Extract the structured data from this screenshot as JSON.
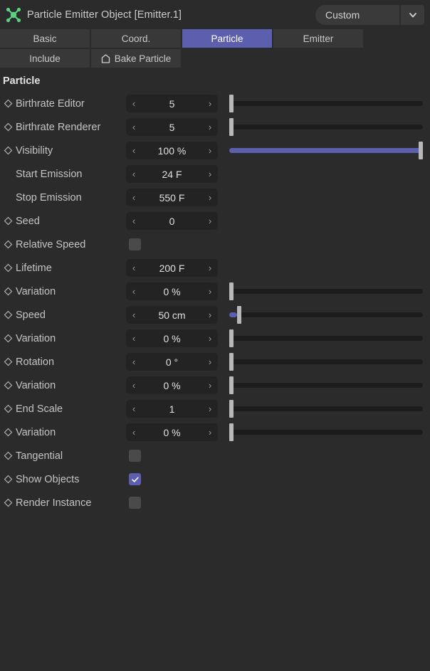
{
  "titlebar": {
    "icon": "particle-emitter-icon",
    "title": "Particle Emitter Object [Emitter.1]",
    "preset_value": "Custom",
    "preset_chevron": "chevron-down-icon"
  },
  "tabs_primary": [
    {
      "label": "Basic",
      "active": false
    },
    {
      "label": "Coord.",
      "active": false
    },
    {
      "label": "Particle",
      "active": true
    },
    {
      "label": "Emitter",
      "active": false
    }
  ],
  "tabs_secondary": [
    {
      "label": "Include",
      "active": false,
      "icon": null
    },
    {
      "label": "Bake Particle",
      "active": false,
      "icon": "bake-home-icon"
    }
  ],
  "section": {
    "title": "Particle"
  },
  "colors": {
    "accent": "#5c5fae",
    "panel_bg": "#2b2b2b",
    "field_bg": "#232323",
    "tab_bg": "#383838",
    "text": "#c4c4c4",
    "handle": "#b8b8b8",
    "icon_green": "#5bd182"
  },
  "properties": [
    {
      "keyframe": true,
      "label": "Birthrate Editor",
      "type": "number",
      "value": "5",
      "prev": "‹",
      "next": "›",
      "slider": {
        "fill_pct": 0,
        "handle_pct": 0
      }
    },
    {
      "keyframe": true,
      "label": "Birthrate Renderer",
      "type": "number",
      "value": "5",
      "prev": "‹",
      "next": "›",
      "slider": {
        "fill_pct": 0,
        "handle_pct": 0
      }
    },
    {
      "keyframe": true,
      "label": "Visibility",
      "type": "number",
      "value": "100 %",
      "prev": "‹",
      "next": "›",
      "slider": {
        "fill_pct": 100,
        "handle_pct": 100
      }
    },
    {
      "keyframe": false,
      "label": "Start Emission",
      "type": "number",
      "value": "24 F",
      "prev": "‹",
      "next": "›",
      "slider": null
    },
    {
      "keyframe": false,
      "label": "Stop Emission",
      "type": "number",
      "value": "550 F",
      "prev": "‹",
      "next": "›",
      "slider": null
    },
    {
      "keyframe": true,
      "label": "Seed",
      "type": "number",
      "value": "0",
      "prev": "‹",
      "next": "›",
      "slider": null
    },
    {
      "keyframe": true,
      "label": "Relative Speed",
      "type": "checkbox",
      "checked": false
    },
    {
      "keyframe": true,
      "label": "Lifetime",
      "type": "number",
      "value": "200 F",
      "prev": "‹",
      "next": "›",
      "slider": null
    },
    {
      "keyframe": true,
      "label": "Variation",
      "type": "number",
      "value": "0 %",
      "prev": "‹",
      "next": "›",
      "slider": {
        "fill_pct": 0,
        "handle_pct": 0
      }
    },
    {
      "keyframe": true,
      "label": "Speed",
      "type": "number",
      "value": "50 cm",
      "prev": "‹",
      "next": "›",
      "slider": {
        "fill_pct": 4,
        "handle_pct": 4
      }
    },
    {
      "keyframe": true,
      "label": "Variation",
      "type": "number",
      "value": "0 %",
      "prev": "‹",
      "next": "›",
      "slider": {
        "fill_pct": 0,
        "handle_pct": 0
      }
    },
    {
      "keyframe": true,
      "label": "Rotation",
      "type": "number",
      "value": "0 °",
      "prev": "‹",
      "next": "›",
      "slider": {
        "fill_pct": 0,
        "handle_pct": 0
      }
    },
    {
      "keyframe": true,
      "label": "Variation",
      "type": "number",
      "value": "0 %",
      "prev": "‹",
      "next": "›",
      "slider": {
        "fill_pct": 0,
        "handle_pct": 0
      }
    },
    {
      "keyframe": true,
      "label": "End Scale",
      "type": "number",
      "value": "1",
      "prev": "‹",
      "next": "›",
      "slider": {
        "fill_pct": 0,
        "handle_pct": 0
      }
    },
    {
      "keyframe": true,
      "label": "Variation",
      "type": "number",
      "value": "0 %",
      "prev": "‹",
      "next": "›",
      "slider": {
        "fill_pct": 0,
        "handle_pct": 0
      }
    },
    {
      "keyframe": true,
      "label": "Tangential",
      "type": "checkbox",
      "checked": false
    },
    {
      "keyframe": true,
      "label": "Show Objects",
      "type": "checkbox",
      "checked": true
    },
    {
      "keyframe": true,
      "label": "Render Instance",
      "type": "checkbox",
      "checked": false
    }
  ]
}
